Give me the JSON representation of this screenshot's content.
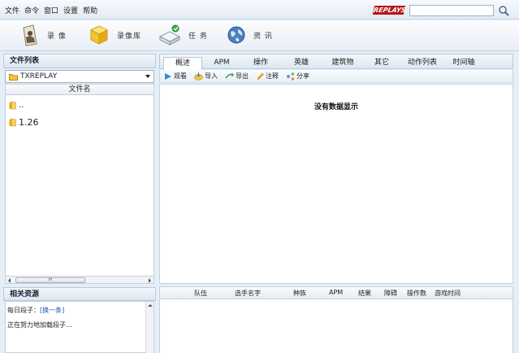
{
  "menu": [
    "文件",
    "命令",
    "窗口",
    "设置",
    "帮助"
  ],
  "logo_text": "REPLAYS",
  "search": {
    "value": "",
    "placeholder": ""
  },
  "toolbar": {
    "replay": "录 像",
    "library": "录像库",
    "tasks": "任 务",
    "news": "资 讯"
  },
  "left": {
    "file_list_title": "文件列表",
    "folder": "TXREPLAY",
    "column_filename": "文件名",
    "items": [
      "..",
      "1.26"
    ],
    "scroll_grip": "III",
    "resources_title": "相关资源",
    "daily_joke": "每日段子：",
    "next_one": "[换一条]",
    "loading": "正在努力地加载段子..."
  },
  "tabs": [
    "概述",
    "APM",
    "操作",
    "英雄",
    "建筑物",
    "其它",
    "动作列表",
    "时间轴"
  ],
  "actions": [
    "观看",
    "导入",
    "导出",
    "注释",
    "分享"
  ],
  "no_data": "没有数据显示",
  "stats_columns": [
    "队伍",
    "选手名字",
    "种族",
    "APM",
    "结果",
    "障碍",
    "操作数",
    "游戏时间"
  ],
  "colors": {
    "window_bg": "#e6eef7",
    "panel_border": "#b9c9da",
    "logo_red": "#b8141b",
    "link_blue": "#1a55b0",
    "folder_yellow": "#f3c640"
  }
}
